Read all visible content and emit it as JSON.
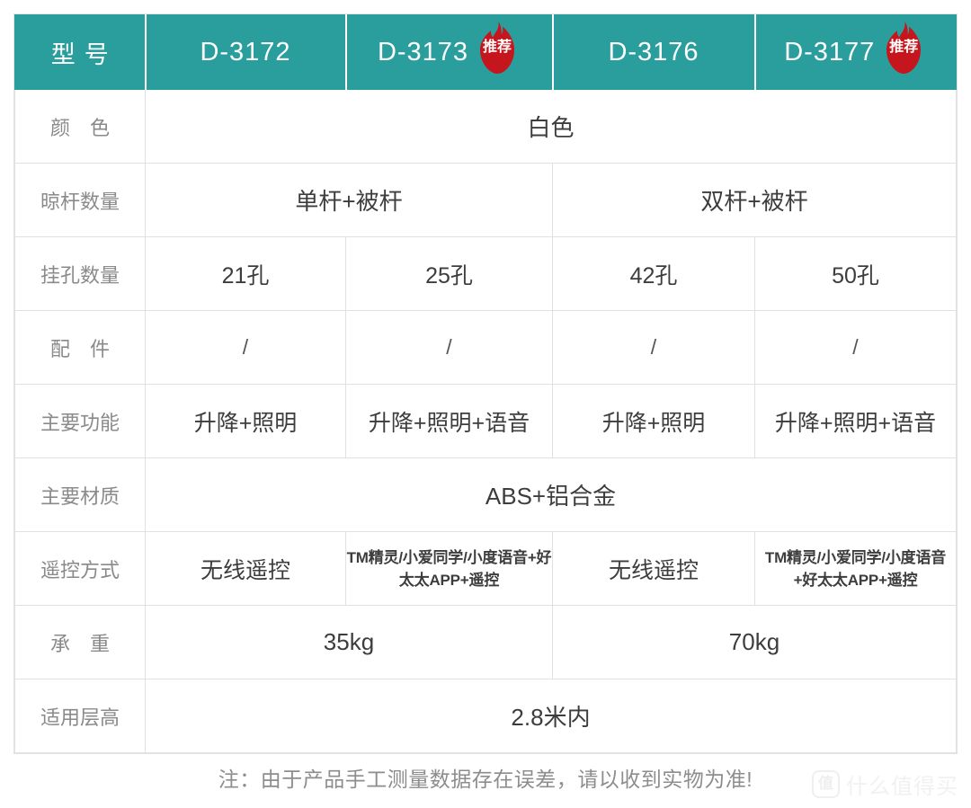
{
  "table": {
    "header": {
      "label": "型号",
      "columns": [
        {
          "model": "D-3172",
          "badge": null
        },
        {
          "model": "D-3173",
          "badge": "推荐"
        },
        {
          "model": "D-3176",
          "badge": null
        },
        {
          "model": "D-3177",
          "badge": "推荐"
        }
      ]
    },
    "rows": [
      {
        "label": "颜  色",
        "cells": [
          {
            "text": "白色",
            "span": 4
          }
        ]
      },
      {
        "label": "晾杆数量",
        "cells": [
          {
            "text": "单杆+被杆",
            "span": 2
          },
          {
            "text": "双杆+被杆",
            "span": 2
          }
        ]
      },
      {
        "label": "挂孔数量",
        "cells": [
          {
            "text": "21孔",
            "span": 1
          },
          {
            "text": "25孔",
            "span": 1
          },
          {
            "text": "42孔",
            "span": 1
          },
          {
            "text": "50孔",
            "span": 1
          }
        ]
      },
      {
        "label": "配  件",
        "cells": [
          {
            "text": "/",
            "span": 1
          },
          {
            "text": "/",
            "span": 1
          },
          {
            "text": "/",
            "span": 1
          },
          {
            "text": "/",
            "span": 1
          }
        ]
      },
      {
        "label": "主要功能",
        "cells": [
          {
            "text": "升降+照明",
            "span": 1
          },
          {
            "text": "升降+照明+语音",
            "span": 1
          },
          {
            "text": "升降+照明",
            "span": 1
          },
          {
            "text": "升降+照明+语音",
            "span": 1
          }
        ]
      },
      {
        "label": "主要材质",
        "cells": [
          {
            "text": "ABS+铝合金",
            "span": 4
          }
        ]
      },
      {
        "label": "遥控方式",
        "cells": [
          {
            "text": "无线遥控",
            "span": 1
          },
          {
            "text": "TM精灵/小爱同学/小度语音+好太太APP+遥控",
            "span": 1
          },
          {
            "text": "无线遥控",
            "span": 1
          },
          {
            "text": "TM精灵/小爱同学/小度语音+好太太APP+遥控",
            "span": 1
          }
        ]
      },
      {
        "label": "承  重",
        "cells": [
          {
            "text": "35kg",
            "span": 2
          },
          {
            "text": "70kg",
            "span": 2
          }
        ]
      },
      {
        "label": "适用层高",
        "cells": [
          {
            "text": "2.8米内",
            "span": 4
          }
        ]
      }
    ]
  },
  "footer": {
    "note": "注：由于产品手工测量数据存在误差，请以收到实物为准!"
  },
  "watermark": {
    "mark": "值",
    "text": "什么值得买"
  },
  "colors": {
    "header_teal": "#2a9d9d",
    "badge_red": "#c5161d",
    "border": "#e1e1e1",
    "label_gray": "#8a8a8a",
    "value_gray": "#3d3d3d"
  }
}
